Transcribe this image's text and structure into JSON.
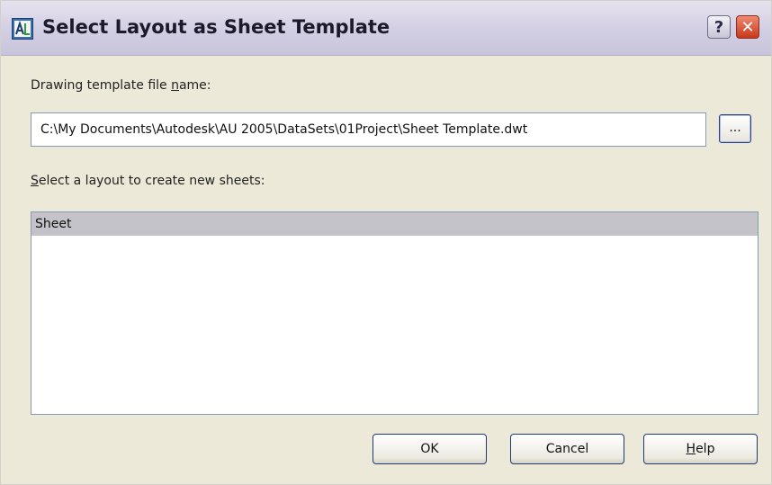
{
  "window": {
    "title": "Select Layout as Sheet Template",
    "icons": {
      "app": "autocad-app-icon",
      "help": "help-icon",
      "close": "close-icon"
    },
    "help_glyph": "?",
    "close_glyph": "✕"
  },
  "template": {
    "label_pre": "Drawing template file ",
    "label_mnemonic": "n",
    "label_post": "ame:",
    "path": "C:\\My Documents\\Autodesk\\AU 2005\\DataSets\\01Project\\Sheet Template.dwt",
    "browse_label": "..."
  },
  "layouts": {
    "label_mnemonic": "S",
    "label_post": "elect a layout to create new sheets:",
    "items": [
      "Sheet"
    ],
    "selected_index": 0
  },
  "buttons": {
    "ok": "OK",
    "cancel": "Cancel",
    "help_mnemonic": "H",
    "help_post": "elp"
  },
  "colors": {
    "selection": "#c3c3c9",
    "close_red": "#c9381b",
    "dialog_face": "#ece9d8"
  }
}
